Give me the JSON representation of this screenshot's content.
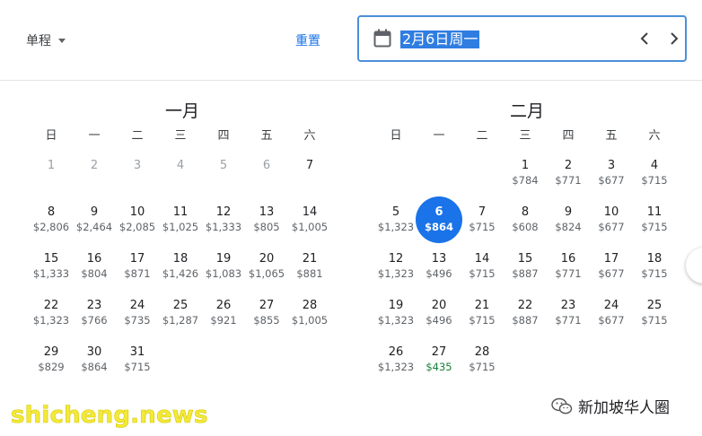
{
  "header": {
    "trip_type": "单程",
    "reset_label": "重置",
    "selected_date": "2月6日周一",
    "icons": [
      "calendar-icon",
      "chevron-left-icon",
      "chevron-right-icon",
      "dropdown-caret-icon"
    ]
  },
  "weekdays": [
    "日",
    "一",
    "二",
    "三",
    "四",
    "五",
    "六"
  ],
  "months": [
    {
      "title": "一月",
      "leading_blanks": 0,
      "days": [
        {
          "day": "1",
          "price": "",
          "past": true
        },
        {
          "day": "2",
          "price": "",
          "past": true
        },
        {
          "day": "3",
          "price": "",
          "past": true
        },
        {
          "day": "4",
          "price": "",
          "past": true
        },
        {
          "day": "5",
          "price": "",
          "past": true
        },
        {
          "day": "6",
          "price": "",
          "past": true
        },
        {
          "day": "7",
          "price": ""
        },
        {
          "day": "8",
          "price": "$2,806"
        },
        {
          "day": "9",
          "price": "$2,464"
        },
        {
          "day": "10",
          "price": "$2,085"
        },
        {
          "day": "11",
          "price": "$1,025"
        },
        {
          "day": "12",
          "price": "$1,333"
        },
        {
          "day": "13",
          "price": "$805"
        },
        {
          "day": "14",
          "price": "$1,005"
        },
        {
          "day": "15",
          "price": "$1,333"
        },
        {
          "day": "16",
          "price": "$804"
        },
        {
          "day": "17",
          "price": "$871"
        },
        {
          "day": "18",
          "price": "$1,426"
        },
        {
          "day": "19",
          "price": "$1,083"
        },
        {
          "day": "20",
          "price": "$1,065"
        },
        {
          "day": "21",
          "price": "$881"
        },
        {
          "day": "22",
          "price": "$1,323"
        },
        {
          "day": "23",
          "price": "$766"
        },
        {
          "day": "24",
          "price": "$735"
        },
        {
          "day": "25",
          "price": "$1,287"
        },
        {
          "day": "26",
          "price": "$921"
        },
        {
          "day": "27",
          "price": "$855"
        },
        {
          "day": "28",
          "price": "$1,005"
        },
        {
          "day": "29",
          "price": "$829"
        },
        {
          "day": "30",
          "price": "$864"
        },
        {
          "day": "31",
          "price": "$715"
        }
      ]
    },
    {
      "title": "二月",
      "leading_blanks": 3,
      "days": [
        {
          "day": "1",
          "price": "$784"
        },
        {
          "day": "2",
          "price": "$771"
        },
        {
          "day": "3",
          "price": "$677"
        },
        {
          "day": "4",
          "price": "$715"
        },
        {
          "day": "5",
          "price": "$1,323"
        },
        {
          "day": "6",
          "price": "$864",
          "selected": true
        },
        {
          "day": "7",
          "price": "$715"
        },
        {
          "day": "8",
          "price": "$608"
        },
        {
          "day": "9",
          "price": "$824"
        },
        {
          "day": "10",
          "price": "$677"
        },
        {
          "day": "11",
          "price": "$715"
        },
        {
          "day": "12",
          "price": "$1,323"
        },
        {
          "day": "13",
          "price": "$496"
        },
        {
          "day": "14",
          "price": "$715"
        },
        {
          "day": "15",
          "price": "$887"
        },
        {
          "day": "16",
          "price": "$771"
        },
        {
          "day": "17",
          "price": "$677"
        },
        {
          "day": "18",
          "price": "$715"
        },
        {
          "day": "19",
          "price": "$1,323"
        },
        {
          "day": "20",
          "price": "$496"
        },
        {
          "day": "21",
          "price": "$715"
        },
        {
          "day": "22",
          "price": "$887"
        },
        {
          "day": "23",
          "price": "$771"
        },
        {
          "day": "24",
          "price": "$677"
        },
        {
          "day": "25",
          "price": "$715"
        },
        {
          "day": "26",
          "price": "$1,323"
        },
        {
          "day": "27",
          "price": "$435",
          "low": true
        },
        {
          "day": "28",
          "price": "$715"
        }
      ]
    }
  ],
  "colors": {
    "accent": "#1a73e8",
    "low_price": "#188038",
    "watermark": "#f3e93a"
  },
  "overlay": {
    "watermark_text": "shicheng.news",
    "brand_text": "新加坡华人圈"
  }
}
